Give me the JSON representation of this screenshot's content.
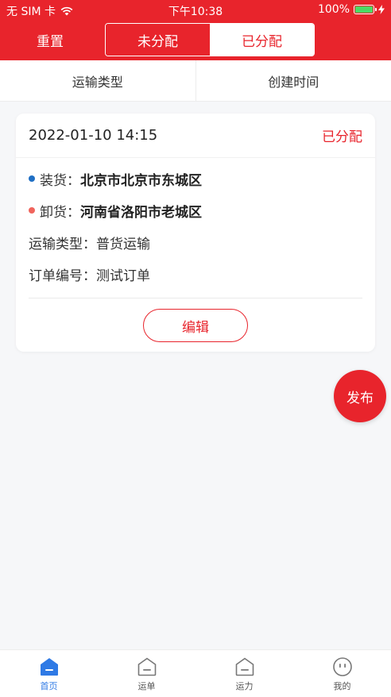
{
  "status_bar": {
    "carrier": "无 SIM 卡",
    "time": "下午10:38",
    "battery": "100%"
  },
  "header": {
    "reset_label": "重置",
    "segments": [
      {
        "label": "未分配",
        "active": false
      },
      {
        "label": "已分配",
        "active": true
      }
    ]
  },
  "filters": [
    {
      "label": "运输类型"
    },
    {
      "label": "创建时间"
    }
  ],
  "order": {
    "date": "2022-01-10 14:15",
    "status": "已分配",
    "load_label": "装货：",
    "load_value": "北京市北京市东城区",
    "unload_label": "卸货：",
    "unload_value": "河南省洛阳市老城区",
    "type_label": "运输类型：",
    "type_value": "普货运输",
    "number_label": "订单编号：",
    "number_value": "测试订单",
    "edit_label": "编辑"
  },
  "fab_label": "发布",
  "tabbar": [
    {
      "label": "首页",
      "icon": "home-icon",
      "active": true
    },
    {
      "label": "运单",
      "icon": "waybill-icon",
      "active": false
    },
    {
      "label": "运力",
      "icon": "capacity-icon",
      "active": false
    },
    {
      "label": "我的",
      "icon": "profile-icon",
      "active": false
    }
  ],
  "colors": {
    "brand_red": "#e8242c",
    "load_dot": "#1f6fc4",
    "unload_dot": "#f0645c",
    "tab_active": "#2f7ae5"
  }
}
